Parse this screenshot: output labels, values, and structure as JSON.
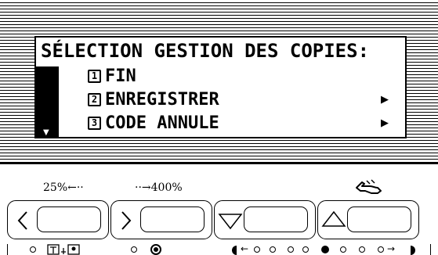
{
  "lcd": {
    "title": "SÉLECTION GESTION DES COPIES:",
    "selector_glyph": "➩",
    "scroll_glyph": "▼",
    "items": [
      {
        "number": "1",
        "label": "FIN",
        "submenu": false
      },
      {
        "number": "2",
        "label": "ENREGISTRER",
        "submenu": true
      },
      {
        "number": "3",
        "label": "CODE ANNULE",
        "submenu": true
      }
    ],
    "submenu_glyph": "▶"
  },
  "buttons": {
    "zoom_down_label": "25%←··",
    "zoom_up_label": "··→400%",
    "reset_icon": "hand-pointer-icon",
    "items": [
      {
        "icon": "chevron-left-icon"
      },
      {
        "icon": "chevron-right-icon"
      },
      {
        "icon": "triangle-down-icon"
      },
      {
        "icon": "triangle-up-icon"
      }
    ]
  },
  "indicators": {
    "exposure_levels": 7,
    "exposure_active": 4
  }
}
